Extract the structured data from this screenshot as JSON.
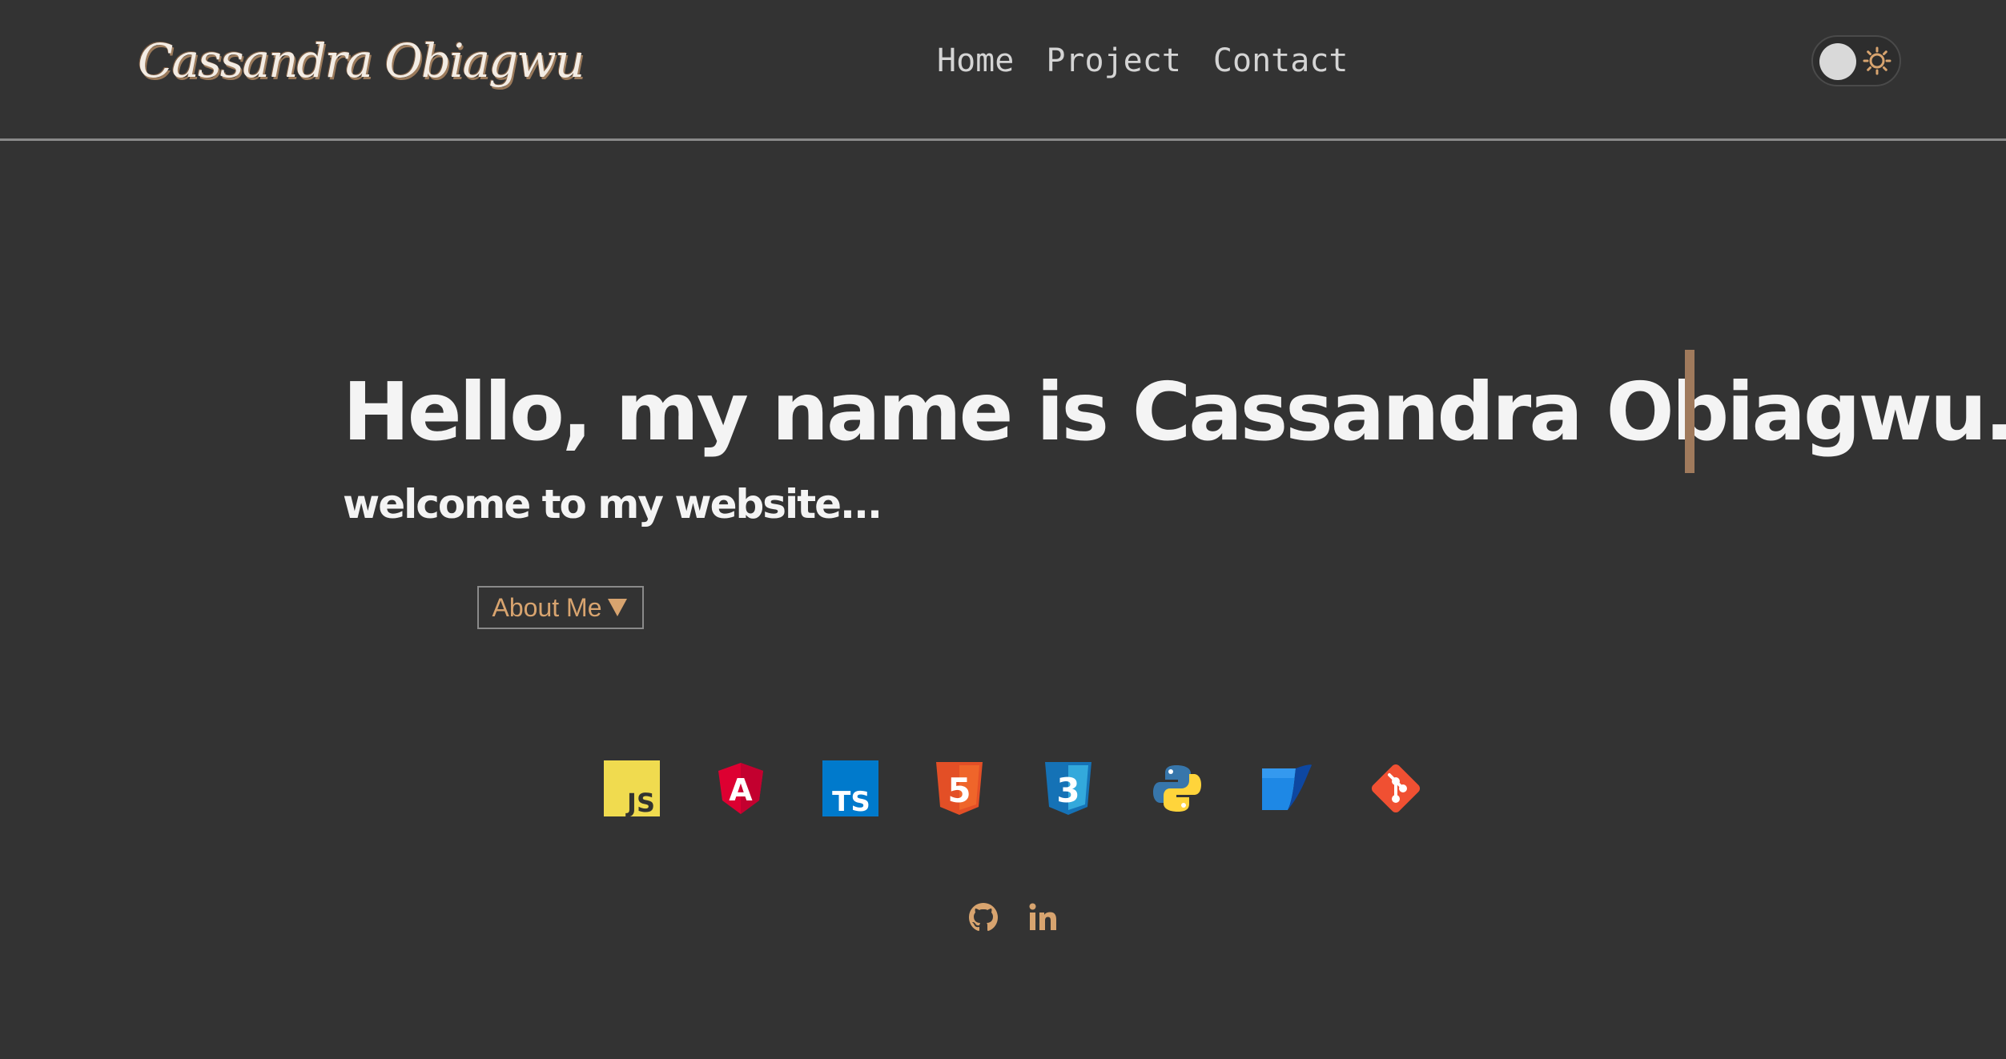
{
  "header": {
    "logo": "Cassandra Obiagwu",
    "nav": [
      {
        "label": "Home"
      },
      {
        "label": "Project"
      },
      {
        "label": "Contact"
      }
    ],
    "theme_toggle": {
      "icon": "sun-icon"
    }
  },
  "hero": {
    "title": "Hello, my name is Cassandra Obiagwu.",
    "subtitle": "welcome to my website...",
    "about_button": {
      "label": "About Me",
      "icon": "caret-down-icon"
    }
  },
  "tech_icons": [
    {
      "name": "javascript-icon",
      "text": "JS",
      "color": "#f0db4f"
    },
    {
      "name": "angular-icon",
      "text": "A",
      "color": "#dd0031"
    },
    {
      "name": "typescript-icon",
      "text": "TS",
      "color": "#007acc"
    },
    {
      "name": "html5-icon",
      "text": "5",
      "color": "#e34f26"
    },
    {
      "name": "css3-icon",
      "text": "3",
      "color": "#1572b6"
    },
    {
      "name": "python-icon",
      "color": "#3776ab"
    },
    {
      "name": "sass-icon",
      "color": "#1e88e5"
    },
    {
      "name": "git-icon",
      "color": "#f05032"
    }
  ],
  "social": [
    {
      "name": "github-icon"
    },
    {
      "name": "linkedin-icon",
      "text": "in"
    }
  ],
  "colors": {
    "background": "#333333",
    "accent": "#d8a46f",
    "text": "#f4f4f4",
    "nav": "#d4d4d4"
  }
}
